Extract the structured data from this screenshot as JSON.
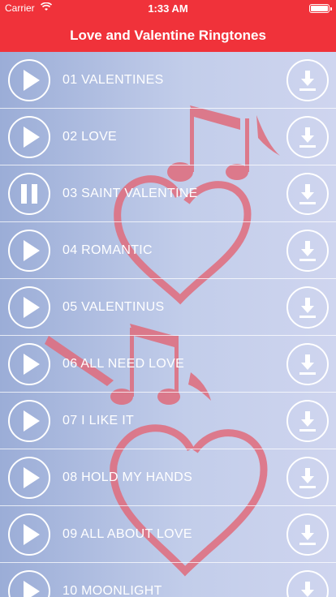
{
  "status_bar": {
    "carrier": "Carrier",
    "time": "1:33 AM"
  },
  "nav": {
    "title": "Love and Valentine Ringtones",
    "color": "#f0323a"
  },
  "tracks": [
    {
      "title": "01 VALENTINES",
      "state": "play"
    },
    {
      "title": "02 LOVE",
      "state": "play"
    },
    {
      "title": "03 SAINT VALENTINE",
      "state": "pause"
    },
    {
      "title": "04 ROMANTIC",
      "state": "play"
    },
    {
      "title": "05 VALENTINUS",
      "state": "play"
    },
    {
      "title": "06 ALL NEED LOVE",
      "state": "play"
    },
    {
      "title": "07 I LIKE IT",
      "state": "play"
    },
    {
      "title": "08 HOLD MY HANDS",
      "state": "play"
    },
    {
      "title": "09 ALL ABOUT LOVE",
      "state": "play"
    },
    {
      "title": "10 MOONLIGHT",
      "state": "play"
    }
  ],
  "icons": {
    "play": "play-icon",
    "pause": "pause-icon",
    "download": "download-icon",
    "background": "heart-music-notes"
  }
}
